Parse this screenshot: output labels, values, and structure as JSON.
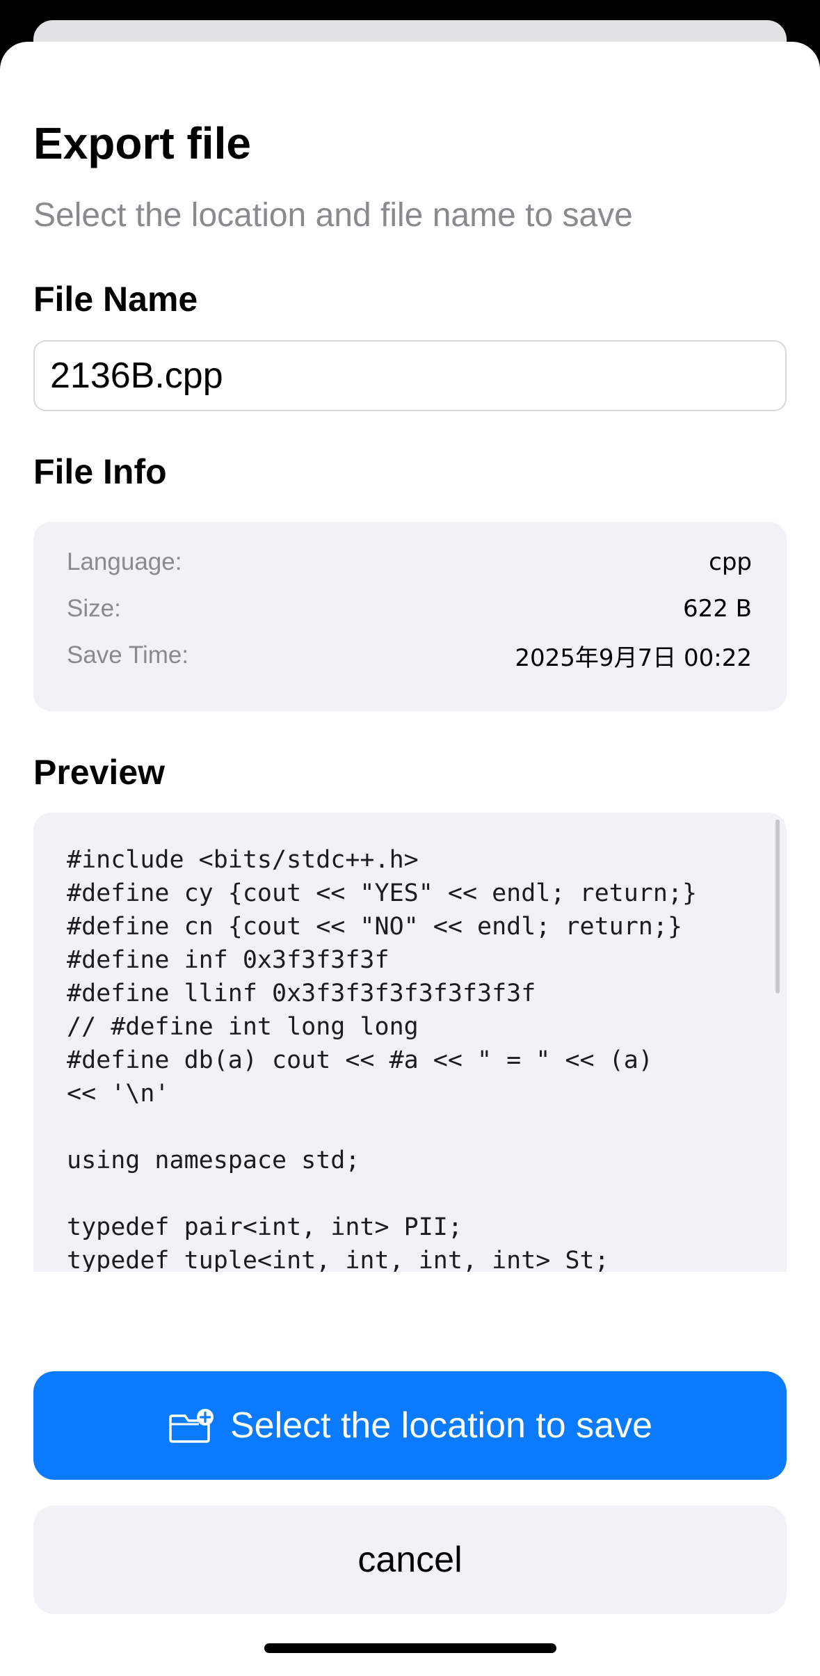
{
  "dialog": {
    "title": "Export file",
    "subtitle": "Select the location and file name to save"
  },
  "file_name": {
    "label": "File Name",
    "value": "2136B.cpp"
  },
  "file_info": {
    "label": "File Info",
    "rows": [
      {
        "key": "Language:",
        "value": "cpp"
      },
      {
        "key": "Size:",
        "value": "622 B"
      },
      {
        "key": "Save Time:",
        "value": "2025年9月7日 00:22"
      }
    ]
  },
  "preview": {
    "label": "Preview",
    "code": "#include <bits/stdc++.h>\n#define cy {cout << \"YES\" << endl; return;}\n#define cn {cout << \"NO\" << endl; return;}\n#define inf 0x3f3f3f3f\n#define llinf 0x3f3f3f3f3f3f3f3f\n// #define int long long\n#define db(a) cout << #a << \" = \" << (a)\n<< '\\n'\n\nusing namespace std;\n\ntypedef pair<int, int> PII;\ntypedef tuple<int, int, int, int> St;"
  },
  "actions": {
    "primary_label": "Select the location to save",
    "primary_icon": "folder-badge-plus-icon",
    "cancel_label": "cancel"
  },
  "colors": {
    "accent": "#0a7aff",
    "card_background": "#f1f1f6",
    "secondary_text": "#8a8a8e"
  }
}
